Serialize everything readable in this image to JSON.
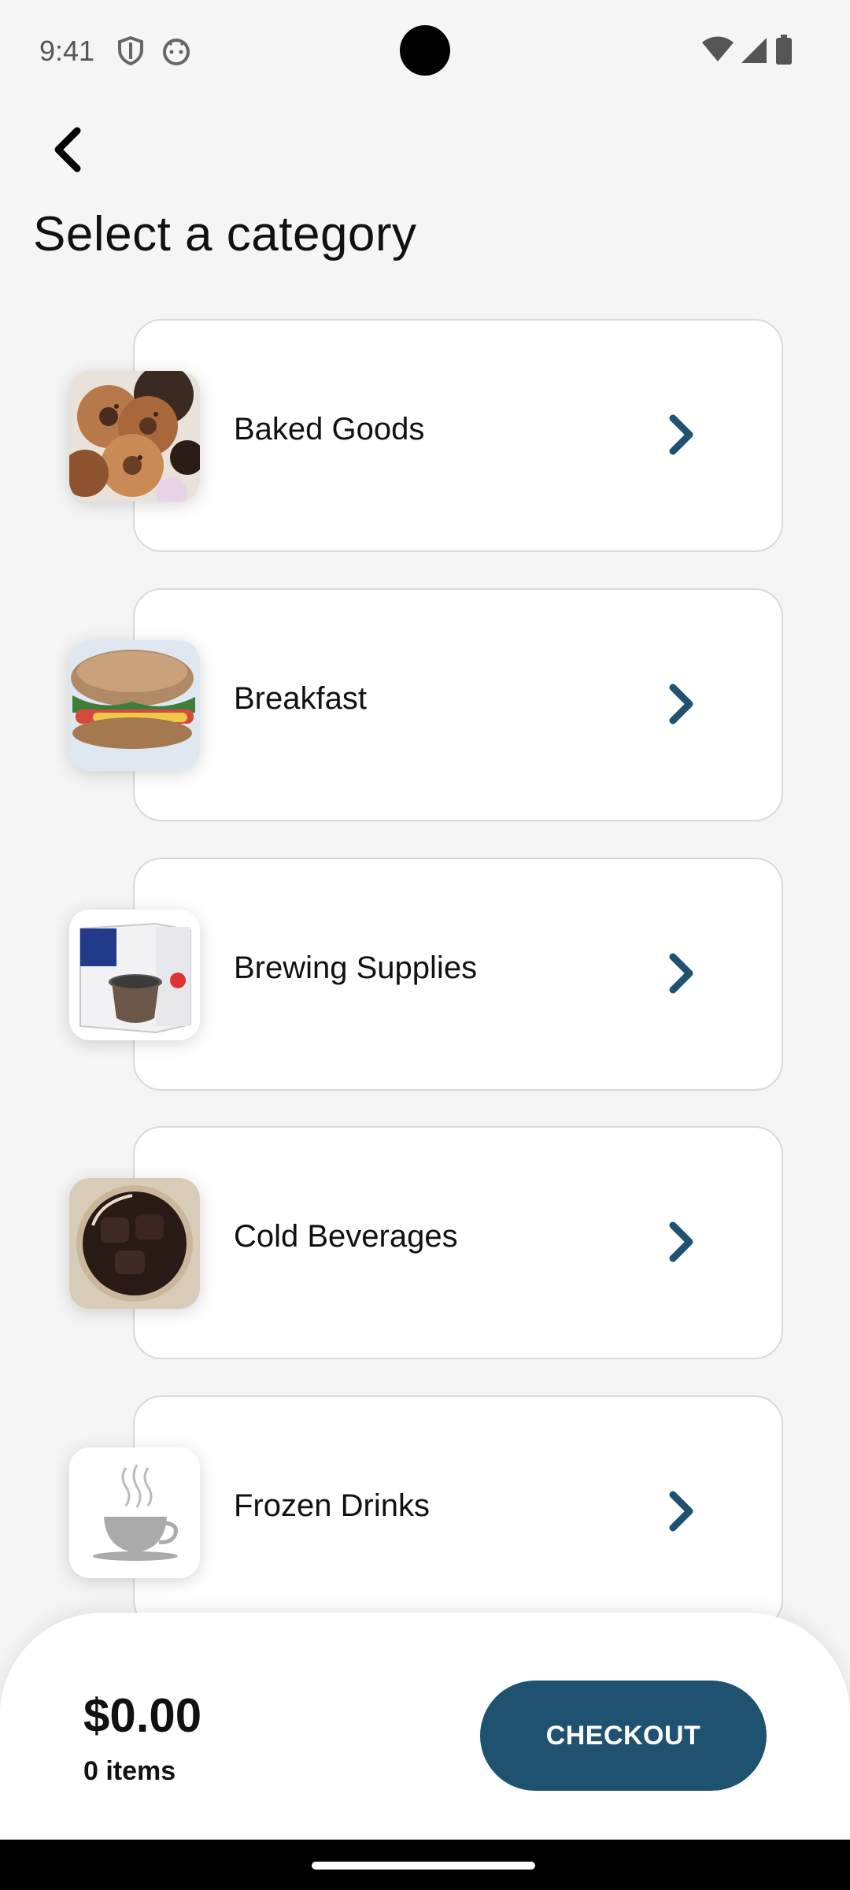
{
  "status_bar": {
    "time": "9:41",
    "icons": [
      "shield-icon",
      "android-face-icon",
      "wifi-icon",
      "signal-icon",
      "battery-icon"
    ]
  },
  "header": {
    "back_icon": "chevron-left-icon",
    "title": "Select a category"
  },
  "categories": [
    {
      "label": "Baked Goods",
      "image": "donuts"
    },
    {
      "label": "Breakfast",
      "image": "breakfast-sandwich"
    },
    {
      "label": "Brewing Supplies",
      "image": "brewing-basket-box"
    },
    {
      "label": "Cold Beverages",
      "image": "iced-coffee"
    },
    {
      "label": "Frozen Drinks",
      "image": "coffee-cup-placeholder"
    }
  ],
  "cart": {
    "total": "$0.00",
    "items": "0 items",
    "checkout_label": "CHECKOUT"
  },
  "colors": {
    "accent": "#1f5171",
    "background": "#f5f5f5",
    "card_border": "#d9d9d9"
  }
}
